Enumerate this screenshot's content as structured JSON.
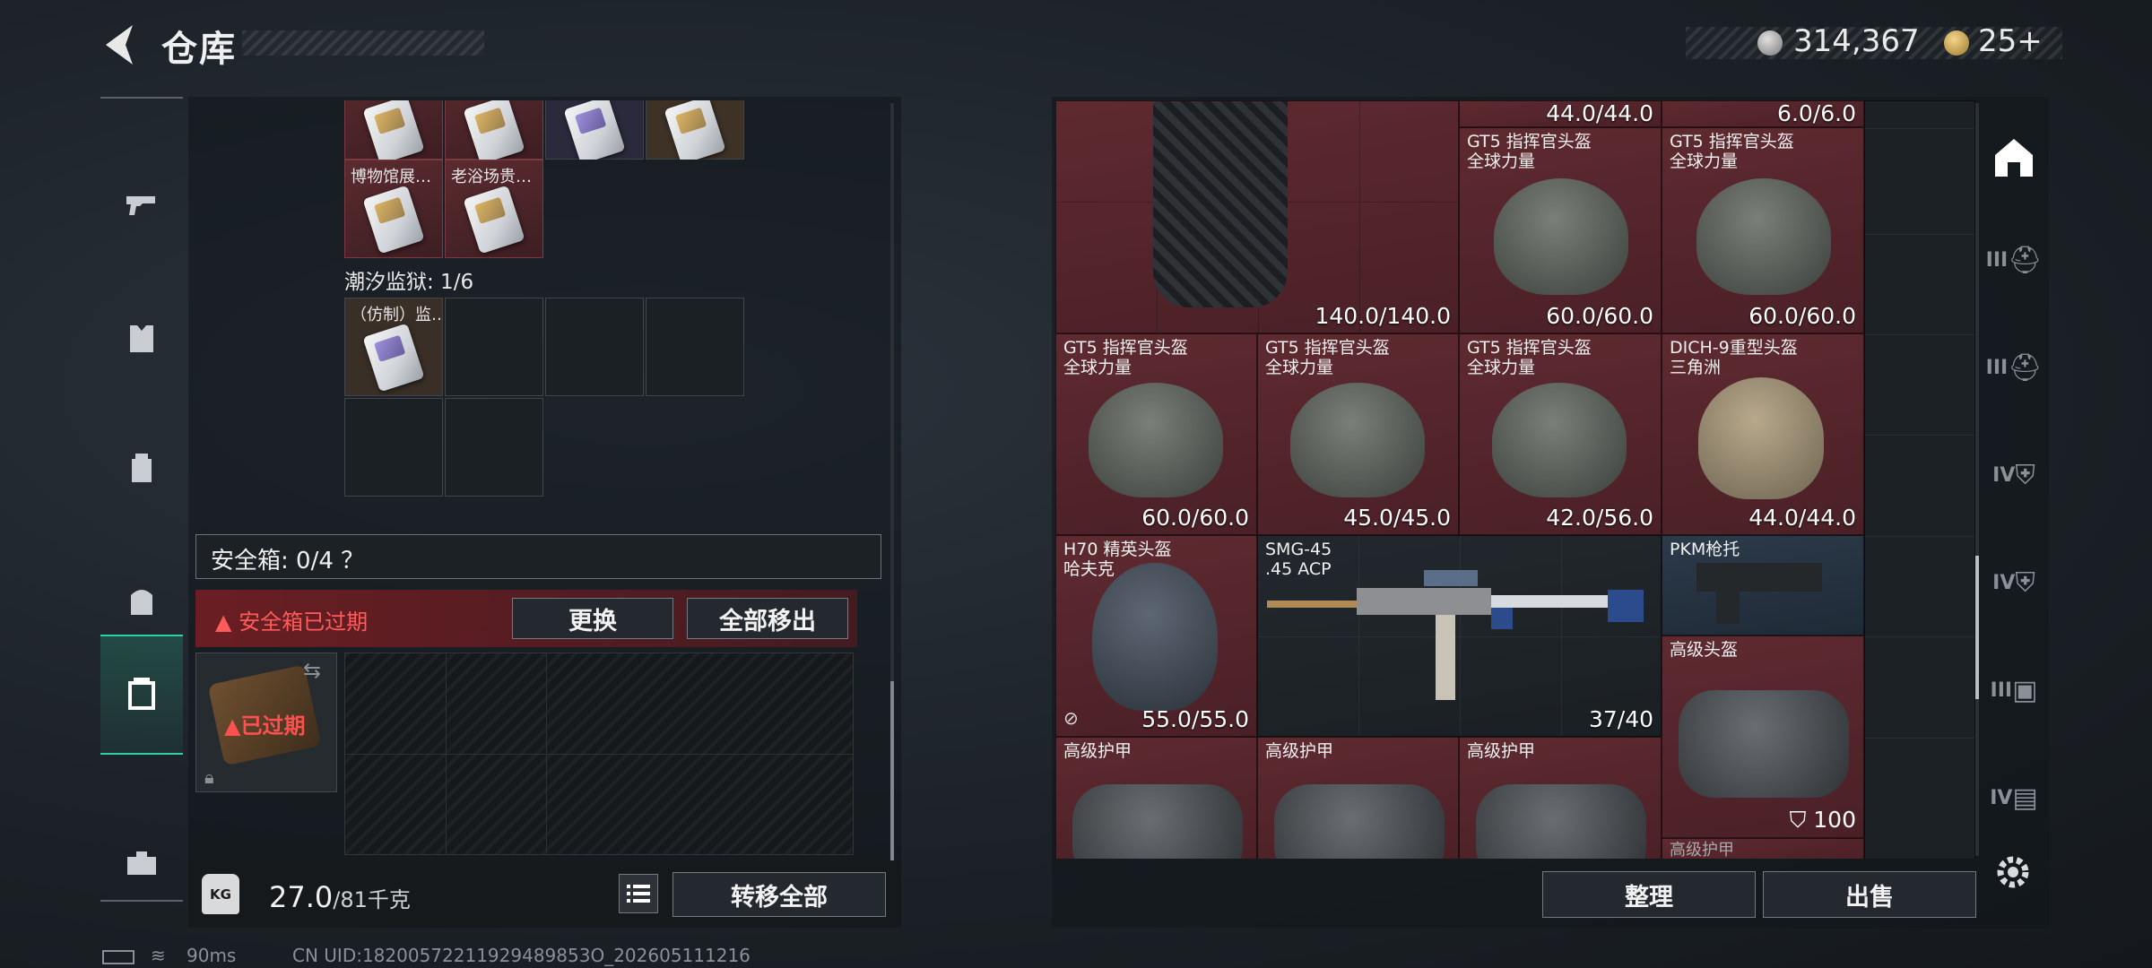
{
  "header": {
    "title": "仓库",
    "currency": {
      "silver": "314,367",
      "gold": "25+"
    }
  },
  "sidebar": {
    "items": [
      {
        "icon": "gun-icon"
      },
      {
        "icon": "vest-icon"
      },
      {
        "icon": "backpack-rig-icon"
      },
      {
        "icon": "backpack-icon"
      },
      {
        "icon": "safe-case-icon",
        "active": true
      },
      {
        "icon": "toolbox-icon"
      }
    ]
  },
  "left": {
    "items_top": [
      {
        "name": "博物馆展…"
      },
      {
        "name": "老浴场贵…"
      }
    ],
    "section2_label": "潮汐监狱: 1/6",
    "section2_items": [
      {
        "name": "（仿制）监…"
      }
    ],
    "safe_box": {
      "label": "安全箱: 0/4 ？",
      "warning": "安全箱已过期",
      "replace_button": "更换",
      "move_all_button": "全部移出",
      "expired_badge": "已过期"
    },
    "weight": {
      "value": "27.0",
      "unit": "/81千克",
      "icon_text": "KG"
    },
    "transfer_all_button": "转移全部"
  },
  "right": {
    "items": [
      {
        "name": "",
        "sub": "",
        "dur": "44.0/44.0",
        "color": "red"
      },
      {
        "name": "",
        "sub": "",
        "dur": "6.0/6.0",
        "color": "red"
      },
      {
        "name": "",
        "sub": "",
        "dur": "140.0/140.0",
        "color": "red"
      },
      {
        "name": "GT5 指挥官头盔",
        "sub": "全球力量",
        "dur": "60.0/60.0",
        "color": "red"
      },
      {
        "name": "GT5 指挥官头盔",
        "sub": "全球力量",
        "dur": "60.0/60.0",
        "color": "red"
      },
      {
        "name": "GT5 指挥官头盔",
        "sub": "全球力量",
        "dur": "60.0/60.0",
        "color": "red"
      },
      {
        "name": "GT5 指挥官头盔",
        "sub": "全球力量",
        "dur": "45.0/45.0",
        "color": "red"
      },
      {
        "name": "GT5 指挥官头盔",
        "sub": "全球力量",
        "dur": "42.0/56.0",
        "color": "red"
      },
      {
        "name": "DICH-9重型头盔",
        "sub": "三角洲",
        "dur": "44.0/44.0",
        "color": "red"
      },
      {
        "name": "H70 精英头盔",
        "sub": "哈夫克",
        "dur": "55.0/55.0",
        "color": "red"
      },
      {
        "name": "SMG-45",
        "sub": ".45 ACP",
        "dur": "37/40",
        "color": "dark"
      },
      {
        "name": "PKM枪托",
        "sub": "",
        "dur": "",
        "color": "blue"
      },
      {
        "name": "高级头盔",
        "sub": "",
        "dur": "100",
        "color": "red"
      },
      {
        "name": "高级护甲",
        "sub": "",
        "dur": "",
        "color": "red"
      },
      {
        "name": "高级护甲",
        "sub": "",
        "dur": "",
        "color": "red"
      },
      {
        "name": "高级护甲",
        "sub": "",
        "dur": "",
        "color": "red"
      },
      {
        "name": "高级护甲",
        "sub": "",
        "dur": "",
        "color": "red"
      }
    ],
    "tidy_button": "整理",
    "sell_button": "出售",
    "filters": [
      "III",
      "III",
      "IV",
      "IV",
      "III",
      "IV"
    ]
  },
  "footer": {
    "ping": "90ms",
    "uid": "CN UID:18200572211929489853O_202605111216"
  }
}
